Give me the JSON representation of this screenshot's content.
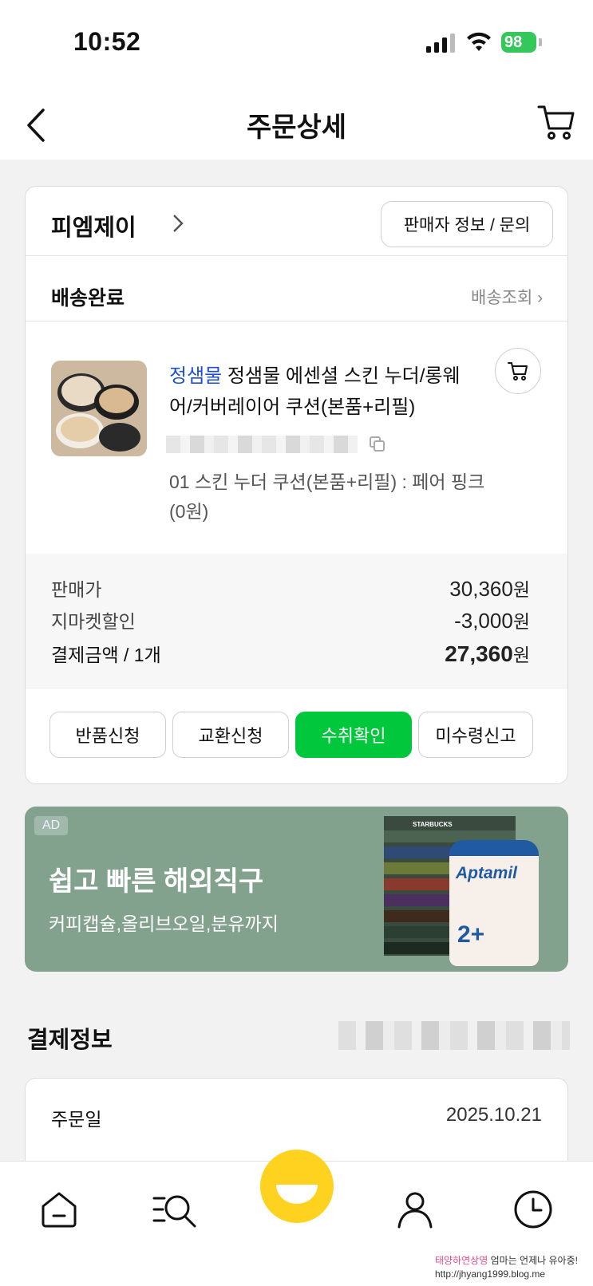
{
  "status_bar": {
    "time": "10:52",
    "battery": "98"
  },
  "header": {
    "title": "주문상세"
  },
  "order": {
    "seller": "피엠제이",
    "seller_info_button": "판매자 정보 / 문의",
    "delivery_status": "배송완료",
    "tracking_link": "배송조회",
    "product": {
      "brand": "정샘물",
      "name": "정샘물 에센셜 스킨 누더/롱웨어/커버레이어 쿠션(본품+리필)",
      "option": "01 스킨 누더 쿠션(본품+리필) : 페어 핑크 (0원)"
    },
    "prices": [
      {
        "label": "판매가",
        "value": "30,360",
        "unit": "원"
      },
      {
        "label": "지마켓할인",
        "value": "-3,000",
        "unit": "원"
      },
      {
        "label": "결제금액 / 1개",
        "value": "27,360",
        "unit": "원"
      }
    ],
    "actions": {
      "return": "반품신청",
      "exchange": "교환신청",
      "confirm": "수취확인",
      "not_received": "미수령신고"
    }
  },
  "ad": {
    "badge": "AD",
    "title": "쉽고 빠른 해외직구",
    "subtitle": "커피캡슐,올리브오일,분유까지",
    "product_brand": "Aptamil",
    "product_stage": "2+",
    "box_brand": "STARBUCKS"
  },
  "payment": {
    "title": "결제정보",
    "rows": [
      {
        "label": "주문일",
        "value": "2025.10.21"
      }
    ]
  },
  "watermark": {
    "line1_pink": "태양하연상영",
    "line1_rest": " 엄마는 언제나 유아중!",
    "line2": "http://jhyang1999.blog.me"
  },
  "colors": {
    "accent_green": "#00c73c",
    "brand_blue": "#1f4fd4",
    "ad_bg": "#82a28e",
    "center_button": "#ffd21f"
  }
}
